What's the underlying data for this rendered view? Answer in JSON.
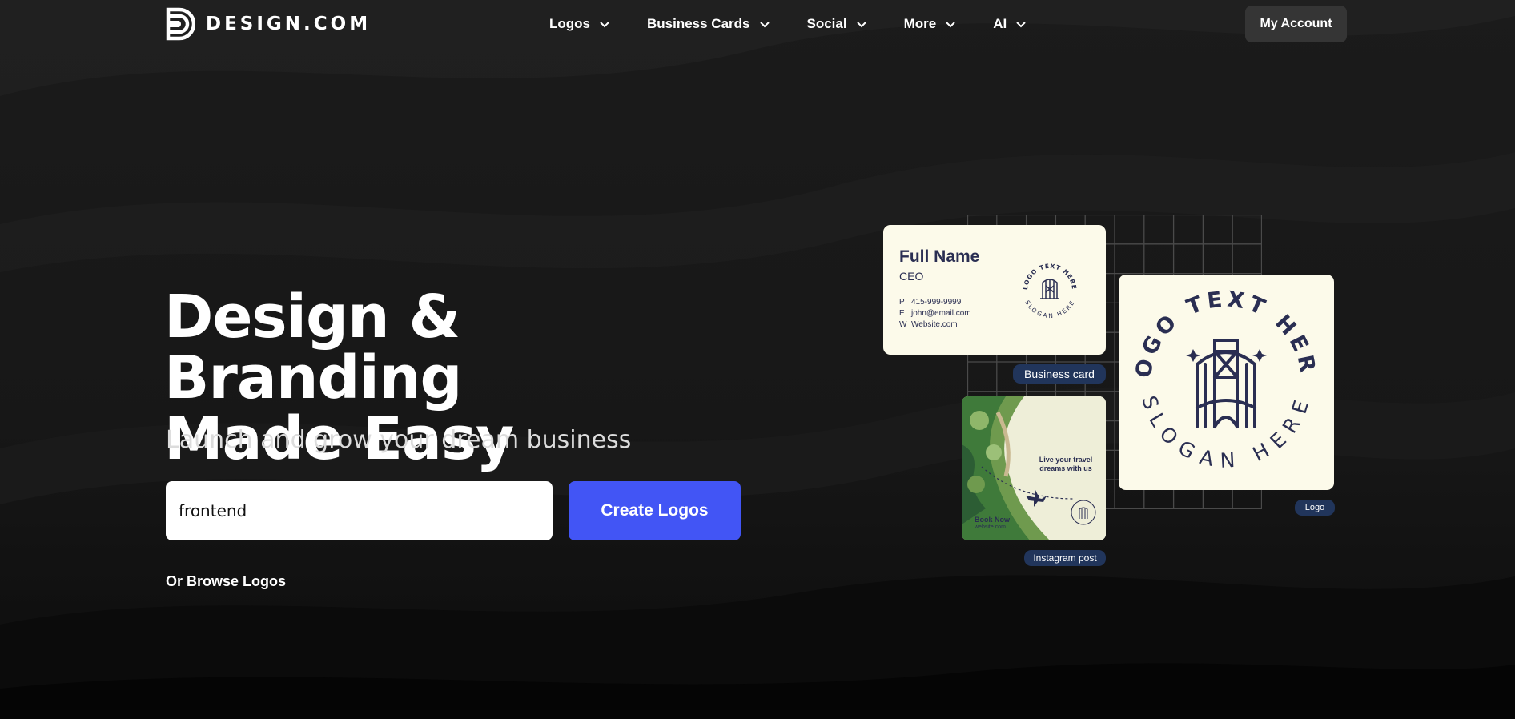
{
  "brand": {
    "name": "DESIGN.COM"
  },
  "nav": {
    "items": [
      {
        "label": "Logos"
      },
      {
        "label": "Business Cards"
      },
      {
        "label": "Social"
      },
      {
        "label": "More"
      },
      {
        "label": "AI"
      }
    ],
    "account_label": "My Account"
  },
  "hero": {
    "title_line1": "Design & Branding",
    "title_line2": "Made Easy",
    "subtitle": "Launch and grow your dream business",
    "search_value": "frontend",
    "cta_label": "Create Logos",
    "browse_label": "Or Browse Logos"
  },
  "showcase": {
    "business_card": {
      "name": "Full Name",
      "role": "CEO",
      "phone_key": "P",
      "phone": "415-999-9999",
      "email_key": "E",
      "email": "john@email.com",
      "web_key": "W",
      "website": "Website.com",
      "pill": "Business card"
    },
    "emblem": {
      "top_text": "LOGO TEXT HERE",
      "bottom_text": "SLOGAN HERE"
    },
    "logo_pill": "Logo",
    "instagram": {
      "tagline": "Live your travel dreams with us",
      "cta": "Book Now",
      "url": "website.com",
      "pill": "Instagram post"
    }
  },
  "colors": {
    "accent": "#4255f5",
    "card_bg": "#fcfaea",
    "ink": "#2a2e52",
    "pill": "#21355b",
    "account_btn": "#353535"
  }
}
